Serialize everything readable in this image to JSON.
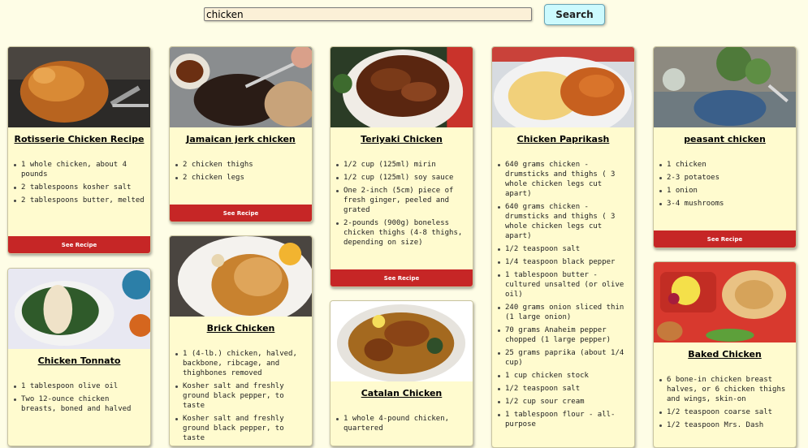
{
  "search": {
    "value": "chicken",
    "button_label": "Search"
  },
  "colors": {
    "page_bg": "#fefde6",
    "card_bg": "#fffbcf",
    "button_red": "#c62626",
    "search_button_bg": "#ccfafe"
  },
  "see_recipe_label": "See Recipe",
  "cards": [
    {
      "title": "Rotisserie Chicken Recipe",
      "ingredients": [
        "1 whole chicken, about 4 pounds",
        "2 tablespoons kosher salt",
        "2 tablespoons butter, melted"
      ]
    },
    {
      "title": "Chicken Tonnato",
      "ingredients": [
        "1 tablespoon olive oil",
        "Two 12-ounce chicken breasts, boned and halved"
      ]
    },
    {
      "title": "Jamaican jerk chicken",
      "ingredients": [
        "2 chicken thighs",
        "2 chicken legs"
      ]
    },
    {
      "title": "Brick Chicken",
      "ingredients": [
        "1 (4-lb.) chicken, halved, backbone, ribcage, and thighbones removed",
        "Kosher salt and freshly ground black pepper, to taste",
        "Kosher salt and freshly ground black pepper, to taste"
      ]
    },
    {
      "title": "Teriyaki Chicken",
      "ingredients": [
        "1/2 cup (125ml) mirin",
        "1/2 cup (125ml) soy sauce",
        "One 2-inch (5cm) piece of fresh ginger, peeled and grated",
        "2-pounds (900g) boneless chicken thighs (4-8 thighs, depending on size)"
      ]
    },
    {
      "title": "Catalan Chicken",
      "ingredients": [
        "1 whole 4-pound chicken, quartered"
      ]
    },
    {
      "title": "Chicken Paprikash",
      "ingredients": [
        "640 grams chicken - drumsticks and thighs ( 3 whole chicken legs cut apart)",
        "640 grams chicken - drumsticks and thighs ( 3 whole chicken legs cut apart)",
        "1/2 teaspoon salt",
        "1/4 teaspoon black pepper",
        "1 tablespoon butter - cultured unsalted (or olive oil)",
        "240 grams onion sliced thin (1 large onion)",
        "70 grams Anaheim pepper chopped (1 large pepper)",
        "25 grams paprika (about 1/4 cup)",
        "1 cup chicken stock",
        "1/2 teaspoon salt",
        "1/2 cup sour cream",
        "1 tablespoon flour - all-purpose"
      ]
    },
    {
      "title": "peasant chicken",
      "ingredients": [
        "1 chicken",
        "2-3 potatoes",
        "1 onion",
        "3-4 mushrooms"
      ]
    },
    {
      "title": "Baked Chicken",
      "ingredients": [
        "6 bone-in chicken breast halves, or 6 chicken thighs and wings, skin-on",
        "1/2 teaspoon coarse salt",
        "1/2 teaspoon Mrs. Dash"
      ]
    }
  ]
}
